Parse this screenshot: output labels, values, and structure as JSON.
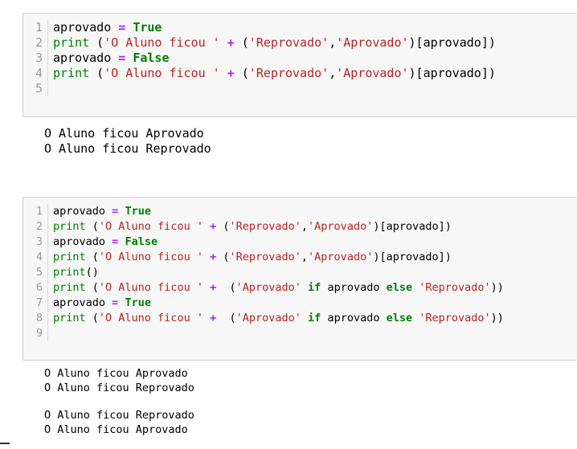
{
  "cell1": {
    "lines": [
      {
        "n": "1",
        "t": [
          [
            "src",
            "aprovado "
          ],
          [
            "op",
            "="
          ],
          [
            "src",
            " "
          ],
          [
            "kw",
            "True"
          ]
        ]
      },
      {
        "n": "2",
        "t": [
          [
            "bi",
            "print"
          ],
          [
            "src",
            " ("
          ],
          [
            "str",
            "'O Aluno ficou '"
          ],
          [
            "src",
            " "
          ],
          [
            "op",
            "+"
          ],
          [
            "src",
            " ("
          ],
          [
            "str",
            "'Reprovado'"
          ],
          [
            "src",
            ","
          ],
          [
            "str",
            "'Aprovado'"
          ],
          [
            "src",
            ")[aprovado])"
          ]
        ]
      },
      {
        "n": "3",
        "t": [
          [
            "src",
            "aprovado "
          ],
          [
            "op",
            "="
          ],
          [
            "src",
            " "
          ],
          [
            "kw",
            "False"
          ]
        ]
      },
      {
        "n": "4",
        "t": [
          [
            "bi",
            "print"
          ],
          [
            "src",
            " ("
          ],
          [
            "str",
            "'O Aluno ficou '"
          ],
          [
            "src",
            " "
          ],
          [
            "op",
            "+"
          ],
          [
            "src",
            " ("
          ],
          [
            "str",
            "'Reprovado'"
          ],
          [
            "src",
            ","
          ],
          [
            "str",
            "'Aprovado'"
          ],
          [
            "src",
            ")[aprovado])"
          ]
        ]
      },
      {
        "n": "5",
        "t": []
      }
    ],
    "output": [
      "O Aluno ficou Aprovado",
      "O Aluno ficou Reprovado"
    ]
  },
  "cell2": {
    "lines": [
      {
        "n": "1",
        "t": [
          [
            "src",
            "aprovado "
          ],
          [
            "op",
            "="
          ],
          [
            "src",
            " "
          ],
          [
            "kw",
            "True"
          ]
        ]
      },
      {
        "n": "2",
        "t": [
          [
            "bi",
            "print"
          ],
          [
            "src",
            " ("
          ],
          [
            "str",
            "'O Aluno ficou '"
          ],
          [
            "src",
            " "
          ],
          [
            "op",
            "+"
          ],
          [
            "src",
            " ("
          ],
          [
            "str",
            "'Reprovado'"
          ],
          [
            "src",
            ","
          ],
          [
            "str",
            "'Aprovado'"
          ],
          [
            "src",
            ")[aprovado])"
          ]
        ]
      },
      {
        "n": "3",
        "t": [
          [
            "src",
            "aprovado "
          ],
          [
            "op",
            "="
          ],
          [
            "src",
            " "
          ],
          [
            "kw",
            "False"
          ]
        ]
      },
      {
        "n": "4",
        "t": [
          [
            "bi",
            "print"
          ],
          [
            "src",
            " ("
          ],
          [
            "str",
            "'O Aluno ficou '"
          ],
          [
            "src",
            " "
          ],
          [
            "op",
            "+"
          ],
          [
            "src",
            " ("
          ],
          [
            "str",
            "'Reprovado'"
          ],
          [
            "src",
            ","
          ],
          [
            "str",
            "'Aprovado'"
          ],
          [
            "src",
            ")[aprovado])"
          ]
        ]
      },
      {
        "n": "5",
        "t": [
          [
            "bi",
            "print"
          ],
          [
            "src",
            "()"
          ]
        ]
      },
      {
        "n": "6",
        "t": [
          [
            "bi",
            "print"
          ],
          [
            "src",
            " ("
          ],
          [
            "str",
            "'O Aluno ficou '"
          ],
          [
            "src",
            " "
          ],
          [
            "op",
            "+"
          ],
          [
            "src",
            "  ("
          ],
          [
            "str",
            "'Aprovado'"
          ],
          [
            "src",
            " "
          ],
          [
            "kw",
            "if"
          ],
          [
            "src",
            " aprovado "
          ],
          [
            "kw",
            "else"
          ],
          [
            "src",
            " "
          ],
          [
            "str",
            "'Reprovado'"
          ],
          [
            "src",
            "))"
          ]
        ]
      },
      {
        "n": "7",
        "t": [
          [
            "src",
            "aprovado "
          ],
          [
            "op",
            "="
          ],
          [
            "src",
            " "
          ],
          [
            "kw",
            "True"
          ]
        ]
      },
      {
        "n": "8",
        "t": [
          [
            "bi",
            "print"
          ],
          [
            "src",
            " ("
          ],
          [
            "str",
            "'O Aluno ficou '"
          ],
          [
            "src",
            " "
          ],
          [
            "op",
            "+"
          ],
          [
            "src",
            "  ("
          ],
          [
            "str",
            "'Aprovado'"
          ],
          [
            "src",
            " "
          ],
          [
            "kw",
            "if"
          ],
          [
            "src",
            " aprovado "
          ],
          [
            "kw",
            "else"
          ],
          [
            "src",
            " "
          ],
          [
            "str",
            "'Reprovado'"
          ],
          [
            "src",
            "))"
          ]
        ]
      },
      {
        "n": "9",
        "t": []
      }
    ],
    "output": [
      "O Aluno ficou Aprovado",
      "O Aluno ficou Reprovado",
      "",
      "O Aluno ficou Reprovado",
      "O Aluno ficou Aprovado"
    ]
  }
}
